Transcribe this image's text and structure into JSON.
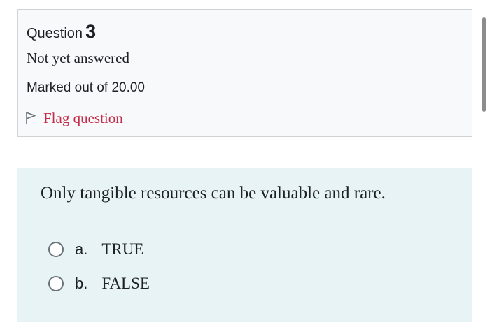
{
  "question_info": {
    "label": "Question",
    "number": "3",
    "state": "Not yet answered",
    "grade": "Marked out of 20.00",
    "flag_label": "Flag question"
  },
  "question": {
    "text": "Only tangible resources can be valuable and rare.",
    "answers": [
      {
        "letter": "a.",
        "text": "TRUE",
        "selected": false
      },
      {
        "letter": "b.",
        "text": "FALSE",
        "selected": false
      }
    ]
  },
  "icons": {
    "flag": "flag-outline-icon"
  },
  "colors": {
    "info_background": "#f8f9fa",
    "info_border": "#cfd3d6",
    "content_background": "#e7f3f5",
    "flag_text": "#c42d4a",
    "text": "#1d2125"
  }
}
